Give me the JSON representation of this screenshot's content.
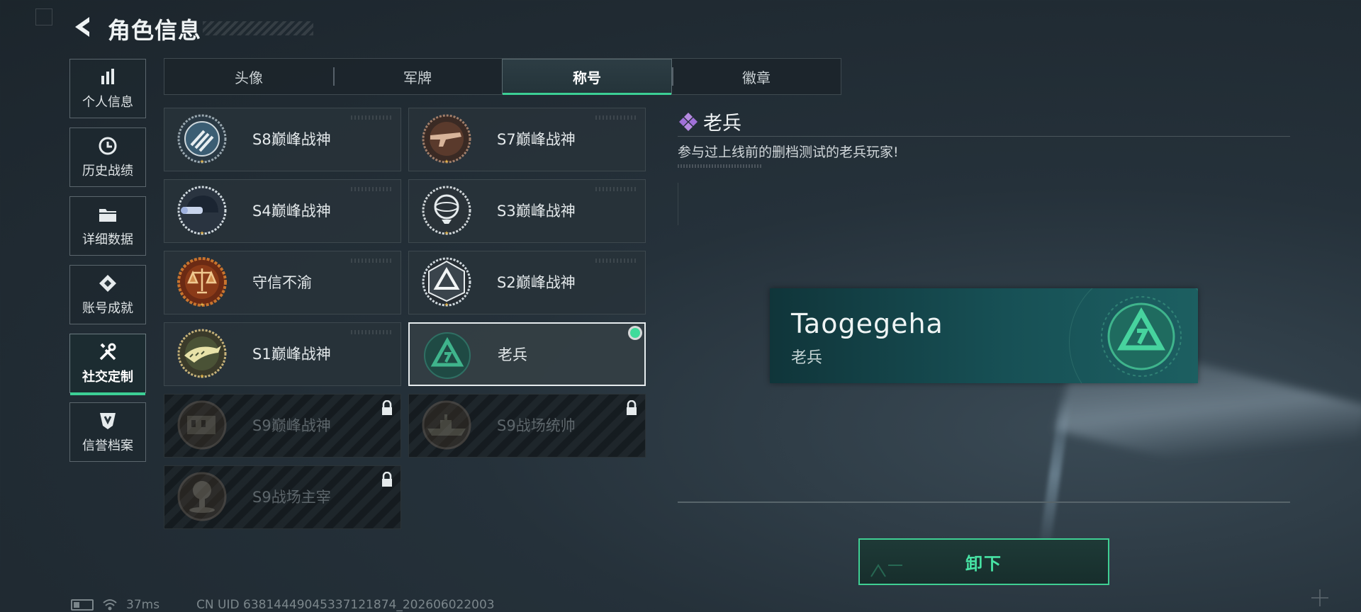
{
  "header": {
    "title": "角色信息"
  },
  "sidebar": {
    "items": [
      {
        "label": "个人信息",
        "icon": "bar-chart-icon"
      },
      {
        "label": "历史战绩",
        "icon": "clock-icon"
      },
      {
        "label": "详细数据",
        "icon": "folder-icon"
      },
      {
        "label": "账号成就",
        "icon": "achievement-icon"
      },
      {
        "label": "社交定制",
        "icon": "tools-icon",
        "active": true
      },
      {
        "label": "信誉档案",
        "icon": "shield-badge-icon"
      }
    ]
  },
  "tabs": [
    {
      "label": "头像"
    },
    {
      "label": "军牌"
    },
    {
      "label": "称号",
      "active": true
    },
    {
      "label": "徽章"
    }
  ],
  "titles": [
    {
      "name": "S8巅峰战神",
      "emblem": "stripes-emblem-icon",
      "locked": false
    },
    {
      "name": "S7巅峰战神",
      "emblem": "rifle-emblem-icon",
      "locked": false
    },
    {
      "name": "S4巅峰战神",
      "emblem": "helmet-emblem-icon",
      "locked": false
    },
    {
      "name": "S3巅峰战神",
      "emblem": "globe-emblem-icon",
      "locked": false
    },
    {
      "name": "守信不渝",
      "emblem": "scales-emblem-icon",
      "locked": false
    },
    {
      "name": "S2巅峰战神",
      "emblem": "triangle-emblem-icon",
      "locked": false
    },
    {
      "name": "S1巅峰战神",
      "emblem": "crocodile-emblem-icon",
      "locked": false
    },
    {
      "name": "老兵",
      "emblem": "veteran-emblem-icon",
      "locked": false,
      "selected": true
    },
    {
      "name": "S9巅峰战神",
      "emblem": "ruins-emblem-icon",
      "locked": true
    },
    {
      "name": "S9战场统帅",
      "emblem": "warship-emblem-icon",
      "locked": true
    },
    {
      "name": "S9战场主宰",
      "emblem": "explosion-emblem-icon",
      "locked": true
    }
  ],
  "detail": {
    "name": "老兵",
    "description": "参与过上线前的删档测试的老兵玩家!",
    "nameplate": {
      "player": "Taogegeha",
      "title": "老兵"
    },
    "unequip_label": "卸下"
  },
  "status": {
    "ping": "37ms",
    "uid": "CN UID 63814449045337121874_202606022003"
  },
  "colors": {
    "accent": "#3ccf95",
    "background": "#25313a",
    "nameplate": "#175055"
  }
}
